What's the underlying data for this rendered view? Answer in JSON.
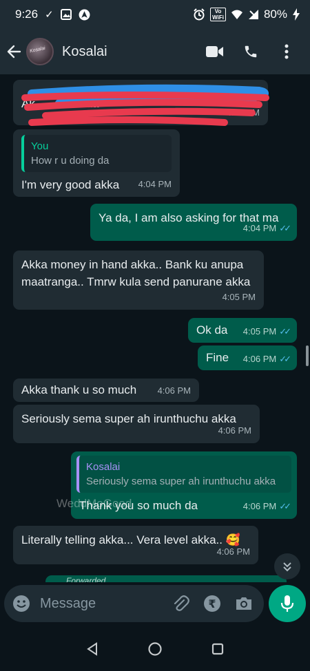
{
  "status_bar": {
    "time": "9:26",
    "battery": "80%",
    "network": "VoLTE WiFi"
  },
  "header": {
    "contact_name": "Kosalai",
    "avatar_text": "Kosalai"
  },
  "messages": [
    {
      "id": "m0",
      "direction": "in",
      "text": "Ak… …st akka",
      "time": "4:04 PM",
      "redacted": true
    },
    {
      "id": "m1",
      "direction": "in",
      "quote_name": "You",
      "quote_text": "How r u doing da",
      "text": "I'm very good akka",
      "time": "4:04 PM"
    },
    {
      "id": "m2",
      "direction": "out",
      "text": "Ya da, I am also asking for that ma",
      "time": "4:04 PM",
      "ticks": "✓✓"
    },
    {
      "id": "m3",
      "direction": "in",
      "text": "Akka money in hand akka.. Bank ku anupa maatranga.. Tmrw kula send panurane akka",
      "time": "4:05 PM"
    },
    {
      "id": "m4",
      "direction": "out",
      "text": "Ok da",
      "time": "4:05 PM",
      "ticks": "✓✓"
    },
    {
      "id": "m5",
      "direction": "out",
      "text": "Fine",
      "time": "4:06 PM",
      "ticks": "✓✓"
    },
    {
      "id": "m6",
      "direction": "in",
      "text": "Akka thank u so much",
      "time": "4:06 PM"
    },
    {
      "id": "m7",
      "direction": "in",
      "text": "Seriously sema super ah irunthuchu akka",
      "time": "4:06 PM"
    },
    {
      "id": "m8",
      "direction": "out",
      "quote_name": "Kosalai",
      "quote_text": "Seriously sema super ah irunthuchu akka",
      "text": "Thank you so much da",
      "time": "4:06 PM",
      "ticks": "✓✓"
    },
    {
      "id": "m9",
      "direction": "in",
      "text": "Literally telling akka... Vera level akka..",
      "emoji": "🥰",
      "time": "4:06 PM"
    }
  ],
  "forwarded_label": "Forwarded",
  "watermark": "WeddMoGood",
  "input": {
    "placeholder": "Message"
  },
  "colors": {
    "incoming": "#202c33",
    "outgoing": "#005c4b",
    "accent": "#00a884",
    "ticks": "#53bdeb"
  },
  "icons": [
    "back-arrow-icon",
    "video-call-icon",
    "voice-call-icon",
    "more-options-icon",
    "emoji-icon",
    "attach-icon",
    "rupee-payment-icon",
    "camera-icon",
    "mic-icon",
    "scroll-down-icon",
    "nav-back-icon",
    "nav-home-icon",
    "nav-recents-icon"
  ]
}
